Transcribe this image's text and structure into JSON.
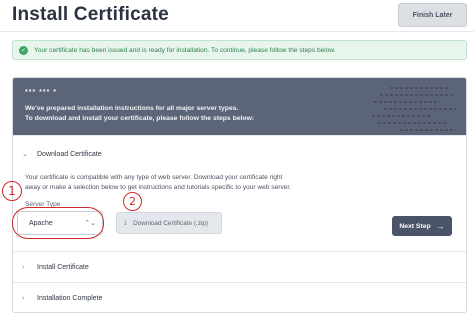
{
  "page": {
    "title": "Install Certificate",
    "finish_later": "Finish Later"
  },
  "alert": {
    "message": "Your certificate has been issued and is ready for installation. To continue, please follow the steps below.",
    "icon": "check-circle-icon",
    "color": "#38a860"
  },
  "card": {
    "cert_id": "*** *** *",
    "intro_line1": "We've prepared installation instructions for all major server types.",
    "intro_line2": "To download and install your certificate, please follow the steps below:",
    "header_color": "#5c6577"
  },
  "steps": [
    {
      "label": "Download Certificate",
      "expanded": true,
      "description_line1": "Your certificate is compatible with any type of web server. Download your certificate right",
      "description_line2": "away or make a selection below to get instructions and tutorials specific to your web server.",
      "server_type_label": "Server Type",
      "server_type_value": "Apache",
      "download_button": "Download Certificate (.zip)",
      "next_button": "Next Step",
      "next_arrow": "→"
    },
    {
      "label": "Install Certificate",
      "expanded": false
    },
    {
      "label": "Installation Complete",
      "expanded": false
    }
  ],
  "annotations": {
    "one": "1",
    "two": "2",
    "color": "#d02a2a"
  }
}
